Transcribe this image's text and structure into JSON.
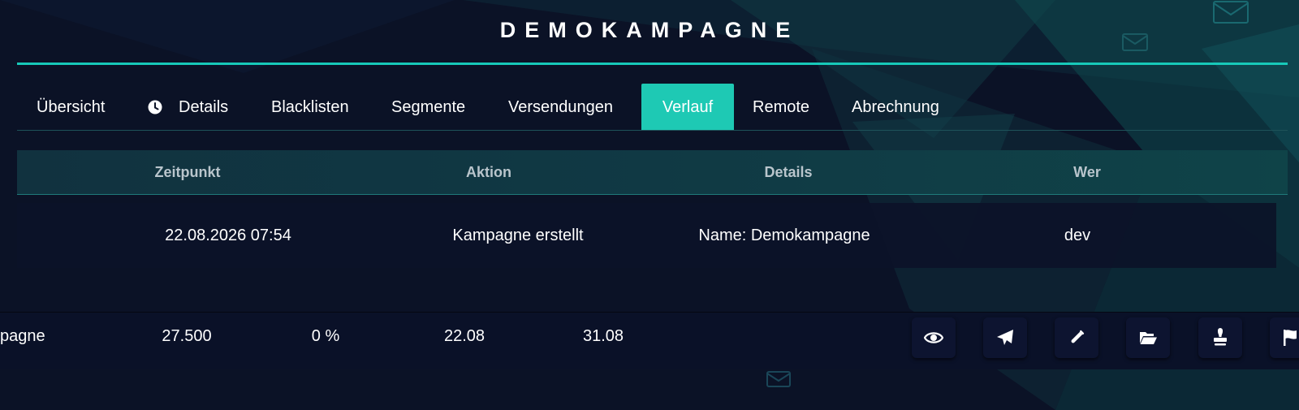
{
  "campaign": {
    "title": "DEMOKAMPAGNE"
  },
  "tabs": [
    {
      "label": "Übersicht"
    },
    {
      "label": "Details",
      "icon": "clock-icon"
    },
    {
      "label": "Blacklisten"
    },
    {
      "label": "Segmente"
    },
    {
      "label": "Versendungen"
    },
    {
      "label": "Verlauf",
      "active": true
    },
    {
      "label": "Remote"
    },
    {
      "label": "Abrechnung"
    }
  ],
  "history_table": {
    "columns": [
      "Zeitpunkt",
      "Aktion",
      "Details",
      "Wer"
    ],
    "rows": [
      {
        "zeitpunkt": "22.08.2026 07:54",
        "aktion": "Kampagne erstellt",
        "details": "Name: Demokampagne",
        "wer": "dev"
      }
    ]
  },
  "campaign_row": {
    "name": "pagne",
    "count": "27.500",
    "percent": "0 %",
    "start": "22.08",
    "end": "31.08",
    "actions": [
      "eye-icon",
      "paper-plane-icon",
      "test-tube-icon",
      "folder-open-icon",
      "stamp-icon",
      "flag-icon"
    ]
  },
  "colors": {
    "accent": "#1ec9b4",
    "background": "#0b1226",
    "header_text": "#b9c5cc"
  }
}
